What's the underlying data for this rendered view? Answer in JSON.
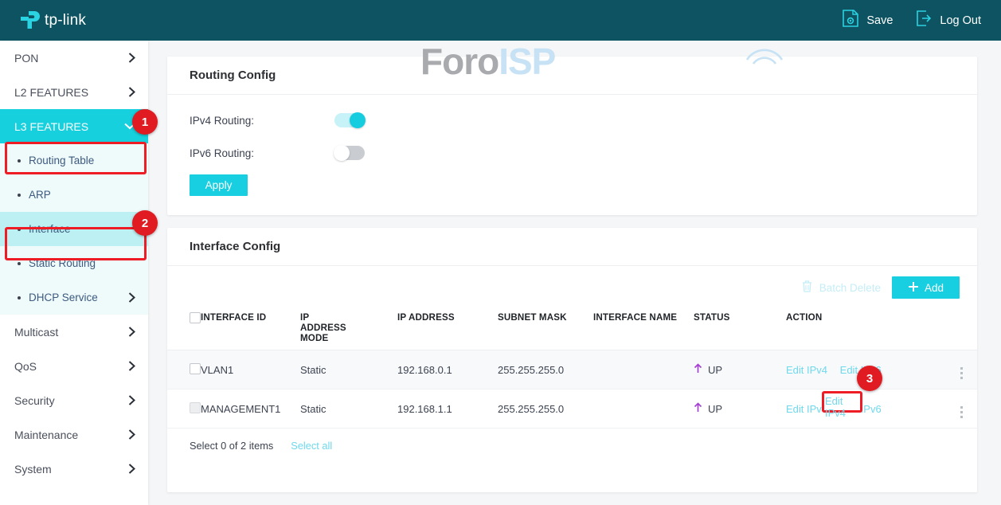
{
  "colors": {
    "header_bg": "#0d5361",
    "accent_cyan": "#17cfe0",
    "accent_light": "#bdf0f2",
    "annotation_red": "#e01b22",
    "status_up": "#a33ad6"
  },
  "topbar": {
    "brand": "tp-link",
    "brand_icon": "tp-link-logo-icon",
    "actions": [
      {
        "label": "Save",
        "icon": "save-gear-document-icon"
      },
      {
        "label": "Log Out",
        "icon": "logout-arrow-icon"
      }
    ]
  },
  "sidebar": {
    "items": [
      {
        "label": "PON",
        "type": "top",
        "icon": "chevron-right-icon",
        "state": "collapsed"
      },
      {
        "label": "L2 FEATURES",
        "type": "top",
        "icon": "chevron-right-icon",
        "state": "collapsed"
      },
      {
        "label": "L3 FEATURES",
        "type": "top",
        "icon": "chevron-down-icon",
        "state": "expanded"
      },
      {
        "label": "Routing Table",
        "type": "sub"
      },
      {
        "label": "ARP",
        "type": "sub"
      },
      {
        "label": "Interface",
        "type": "sub",
        "state": "selected"
      },
      {
        "label": "Static Routing",
        "type": "sub"
      },
      {
        "label": "DHCP Service",
        "type": "sub",
        "icon": "chevron-right-icon"
      },
      {
        "label": "Multicast",
        "type": "top",
        "icon": "chevron-right-icon"
      },
      {
        "label": "QoS",
        "type": "top",
        "icon": "chevron-right-icon"
      },
      {
        "label": "Security",
        "type": "top",
        "icon": "chevron-right-icon"
      },
      {
        "label": "Maintenance",
        "type": "top",
        "icon": "chevron-right-icon"
      },
      {
        "label": "System",
        "type": "top",
        "icon": "chevron-right-icon"
      }
    ]
  },
  "annotations": [
    {
      "number": "1",
      "target": "L3 FEATURES menu"
    },
    {
      "number": "2",
      "target": "Interface submenu"
    },
    {
      "number": "3",
      "target": "Edit IPv4 link on MANAGEMENT1 row"
    }
  ],
  "routing_config": {
    "title": "Routing Config",
    "fields": [
      {
        "label": "IPv4 Routing:",
        "value": "on"
      },
      {
        "label": "IPv6 Routing:",
        "value": "off"
      }
    ],
    "apply_label": "Apply"
  },
  "watermark": {
    "part1": "Foro",
    "part2": "ISP"
  },
  "interface_config": {
    "title": "Interface Config",
    "toolbar": {
      "batch_delete_label": "Batch Delete",
      "batch_delete_icon": "trash-icon",
      "add_label": "Add",
      "add_icon": "plus-icon"
    },
    "columns": [
      "INTERFACE ID",
      "IP ADDRESS MODE",
      "IP ADDRESS",
      "SUBNET MASK",
      "INTERFACE NAME",
      "STATUS",
      "ACTION"
    ],
    "rows": [
      {
        "checkbox": "unchecked",
        "interface_id": "VLAN1",
        "ip_address_mode": "Static",
        "ip_address": "192.168.0.1",
        "subnet_mask": "255.255.255.0",
        "interface_name": "",
        "status": "UP",
        "status_icon": "arrow-up-icon",
        "action_ipv4": "Edit IPv4",
        "action_ipv6": "Edit IPv6",
        "menu_icon": "vertical-dots-icon"
      },
      {
        "checkbox": "disabled",
        "interface_id": "MANAGEMENT1",
        "ip_address_mode": "Static",
        "ip_address": "192.168.1.1",
        "subnet_mask": "255.255.255.0",
        "interface_name": "",
        "status": "UP",
        "status_icon": "arrow-up-icon",
        "action_ipv4": "Edit IPv4",
        "action_ipv6": "Edit IPv6",
        "menu_icon": "vertical-dots-icon"
      }
    ],
    "footer": {
      "select_text": "Select 0 of 2 items",
      "select_all_label": "Select all"
    }
  }
}
